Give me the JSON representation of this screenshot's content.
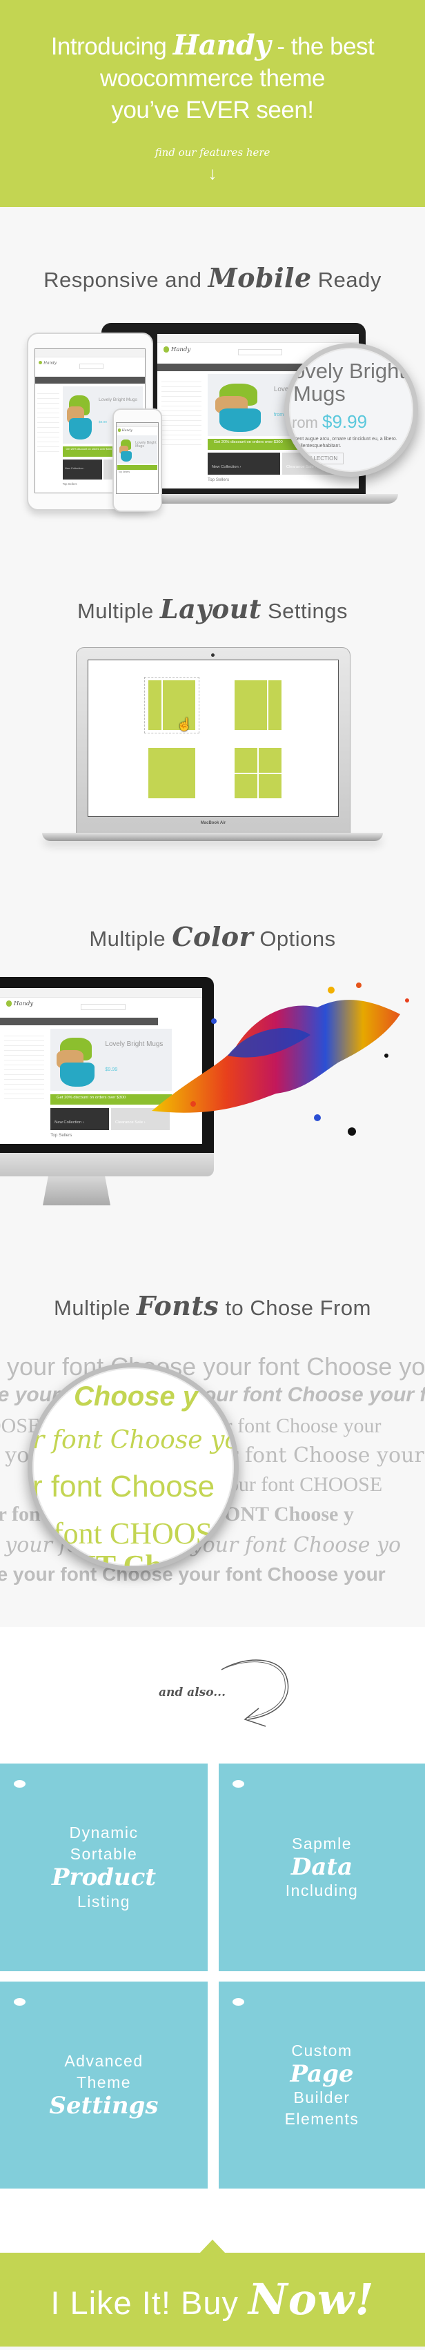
{
  "hero": {
    "intro": "Introducing",
    "brand": "Handy",
    "rest1": "- the best",
    "line2": "woocommerce theme",
    "line3": "you’ve EVER seen!",
    "cta_hint": "find our features here",
    "arrow": "↓"
  },
  "sections": {
    "responsive": {
      "pre": "Responsive and",
      "script": "Mobile",
      "post": "Ready"
    },
    "layout": {
      "pre": "Multiple",
      "script": "Layout",
      "post": "Settings",
      "device_label": "MacBook Air"
    },
    "color": {
      "pre": "Multiple",
      "script": "Color",
      "post": "Options"
    },
    "fonts": {
      "pre": "Multiple",
      "script": "Fonts",
      "post": "to Chose From",
      "sample": "Choose your font",
      "rows": [
        "e your font   Choose your font   Choose your font",
        "se your font   Choose your font   Choose your font",
        "OOSE your font   Choose your font   Choose your",
        "e your font   Choose your font   Choose your",
        "your font   Choose your font   CHOOSE",
        "ur font   CHOOSE YOUR FONT   Choose y",
        "e your font   Choose your font   Choose yo",
        "se your font   Choose your font   Choose your"
      ],
      "lens_rows": [
        "Choose y",
        "r font  Choose yo",
        "r font  Choose",
        "font  CHOOS",
        "NT  Ch"
      ]
    }
  },
  "mockup": {
    "logo": "Handy",
    "title": "Lovely Bright Mugs",
    "price": "$9.99",
    "price_prefix": "from",
    "banner": "Get 20% discount on orders over $300",
    "tile1": "New Collection ›",
    "tile2": "Clearance Sale ›",
    "top_sellers": "Top Sellers",
    "lens": {
      "title1": "ovely Bright",
      "title2": "Mugs",
      "price_prefix": "rom",
      "price": "$9.99",
      "desc": "sent augue arcu, ornare ut tincidunt eu, a libero. Pellentesquehabitant.",
      "button": "LLECTION"
    }
  },
  "also": {
    "label": "and also..."
  },
  "features": [
    {
      "lines": [
        "Dynamic",
        "Sortable"
      ],
      "script": "Product",
      "after": [
        "Listing"
      ]
    },
    {
      "lines": [
        "Sapmle"
      ],
      "script": "Data",
      "after": [
        "Including"
      ]
    },
    {
      "lines": [
        "Advanced",
        "Theme"
      ],
      "script": "Settings",
      "after": []
    },
    {
      "lines": [
        "Custom"
      ],
      "script": "Page",
      "after": [
        "Builder",
        "Elements"
      ]
    }
  ],
  "cta": {
    "text": "I Like It! Buy",
    "script": "Now!"
  },
  "colors": {
    "brand_green": "#c3d552",
    "tile_blue": "#82ceda",
    "price_blue": "#5bc8dc",
    "background": "#f7f7f7"
  }
}
